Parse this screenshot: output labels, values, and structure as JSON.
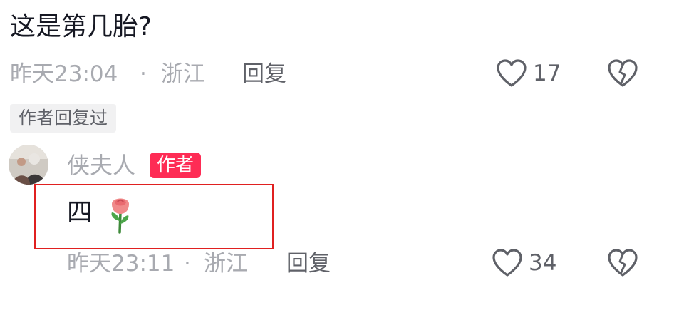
{
  "comment": {
    "text": "这是第几胎?",
    "time": "昨天23:04",
    "separator": "·",
    "location": "浙江",
    "reply_label": "回复",
    "like_count": "17",
    "author_replied_label": "作者回复过"
  },
  "reply": {
    "nickname": "侠夫人",
    "author_badge": "作者",
    "text": "四",
    "emoji_icon": "rose-icon",
    "time": "昨天23:11",
    "separator": "·",
    "location": "浙江",
    "reply_label": "回复",
    "like_count": "34"
  },
  "colors": {
    "badge": "#fe2c55",
    "highlight_border": "#e02020",
    "meta_text": "#a8aab0",
    "primary_text": "#161823"
  }
}
